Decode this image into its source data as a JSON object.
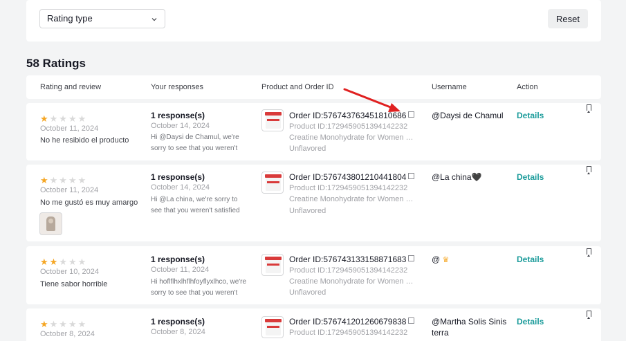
{
  "filter": {
    "rating_type_label": "Rating type",
    "chevron": "⌄",
    "reset_label": "Reset"
  },
  "summary": {
    "heading": "58 Ratings"
  },
  "columns": {
    "rating": "Rating and review",
    "responses": "Your responses",
    "product": "Product and Order ID",
    "username": "Username",
    "action": "Action"
  },
  "rows": [
    {
      "stars": 1,
      "date": "October 11, 2024",
      "review": "No he resibido el producto",
      "response_count": "1 response(s)",
      "response_date": "October 14, 2024",
      "response_text": "Hi @Daysi de Chamul, we're sorry to see that you weren't sati...",
      "order_id": "Order ID:576743763451810686",
      "product_id": "Product ID:1729459051394142232",
      "product_name": "Creatine Monohydrate for Women with ...",
      "variant": "Unflavored",
      "username": "@Daysi de Chamul",
      "action": "Details"
    },
    {
      "stars": 1,
      "date": "October 11, 2024",
      "review": "No me gustó es muy amargo",
      "response_count": "1 response(s)",
      "response_date": "October 14, 2024",
      "response_text": "Hi @La china, we're sorry to see that you weren't satisfied with...",
      "order_id": "Order ID:576743801210441804",
      "product_id": "Product ID:1729459051394142232",
      "product_name": "Creatine Monohydrate for Women with ...",
      "variant": "Unflavored",
      "username": "@La china🖤",
      "action": "Details"
    },
    {
      "stars": 2,
      "date": "October 10, 2024",
      "review": "Tiene sabor horrible",
      "response_count": "1 response(s)",
      "response_date": "October 11, 2024",
      "response_text": "Hi hoflflhxlhflhfoyflyxlhco, we're sorry to see that you weren't sa...",
      "order_id": "Order ID:576743133158871683",
      "product_id": "Product ID:1729459051394142232",
      "product_name": "Creatine Monohydrate for Women with ...",
      "variant": "Unflavored",
      "username": "@",
      "username_icon": "crown-icon",
      "action": "Details"
    },
    {
      "stars": 1,
      "date": "October 8, 2024",
      "response_count": "1 response(s)",
      "response_date": "October 8, 2024",
      "order_id": "Order ID:576741201260679838",
      "product_id": "Product ID:1729459051394142232",
      "username_line1": "@Martha Solis Sinis",
      "username_line2": "terra",
      "action": "Details"
    }
  ],
  "colors": {
    "accent": "#1a9b9a",
    "star": "#f5a623",
    "arrow": "#e02020"
  }
}
